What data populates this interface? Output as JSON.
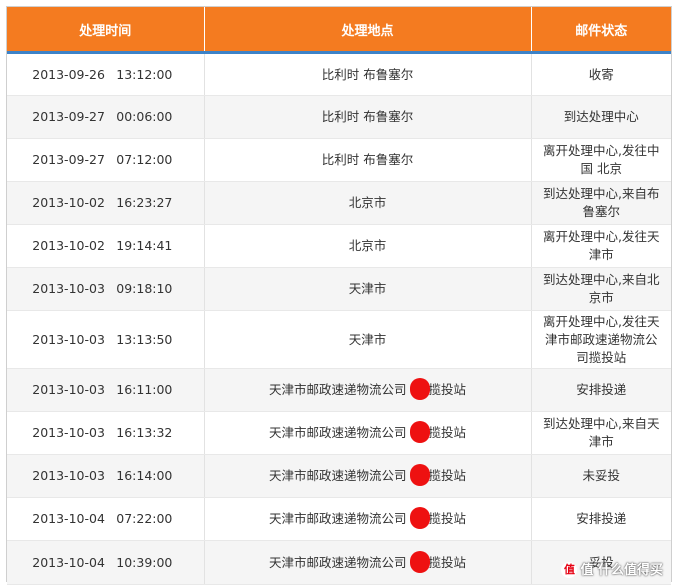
{
  "header": {
    "col_time": "处理时间",
    "col_location": "处理地点",
    "col_status": "邮件状态"
  },
  "rows": [
    {
      "date": "2013-09-26",
      "time": "13:12:00",
      "location": "比利时 布鲁塞尔",
      "status": "收寄"
    },
    {
      "date": "2013-09-27",
      "time": "00:06:00",
      "location": "比利时 布鲁塞尔",
      "status": "到达处理中心"
    },
    {
      "date": "2013-09-27",
      "time": "07:12:00",
      "location": "比利时 布鲁塞尔",
      "status": "离开处理中心,发往中国 北京"
    },
    {
      "date": "2013-10-02",
      "time": "16:23:27",
      "location": "北京市",
      "status": "到达处理中心,来自布鲁塞尔"
    },
    {
      "date": "2013-10-02",
      "time": "19:14:41",
      "location": "北京市",
      "status": "离开处理中心,发往天津市"
    },
    {
      "date": "2013-10-03",
      "time": "09:18:10",
      "location": "天津市",
      "status": "到达处理中心,来自北京市"
    },
    {
      "date": "2013-10-03",
      "time": "13:13:50",
      "location": "天津市",
      "status": "离开处理中心,发往天津市邮政速递物流公司揽投站"
    },
    {
      "date": "2013-10-03",
      "time": "16:11:00",
      "location_a": "天津市邮政速递物流公司",
      "location_b": "揽投站",
      "status": "安排投递"
    },
    {
      "date": "2013-10-03",
      "time": "16:13:32",
      "location_a": "天津市邮政速递物流公司",
      "location_b": "揽投站",
      "status": "到达处理中心,来自天津市"
    },
    {
      "date": "2013-10-03",
      "time": "16:14:00",
      "location_a": "天津市邮政速递物流公司",
      "location_b": "揽投站",
      "status": "未妥投"
    },
    {
      "date": "2013-10-04",
      "time": "07:22:00",
      "location_a": "天津市邮政速递物流公司",
      "location_b": "揽投站",
      "status": "安排投递"
    },
    {
      "date": "2013-10-04",
      "time": "10:39:00",
      "location_a": "天津市邮政速递物流公司",
      "location_b": "揽投站",
      "status": "妥投"
    }
  ],
  "watermark": {
    "text": "值 什么值得买",
    "badge": "值"
  },
  "colors": {
    "header_bg": "#f47b20",
    "header_underline": "#3d83c8",
    "redaction": "#ee1111",
    "alt_row": "#f5f5f5"
  }
}
